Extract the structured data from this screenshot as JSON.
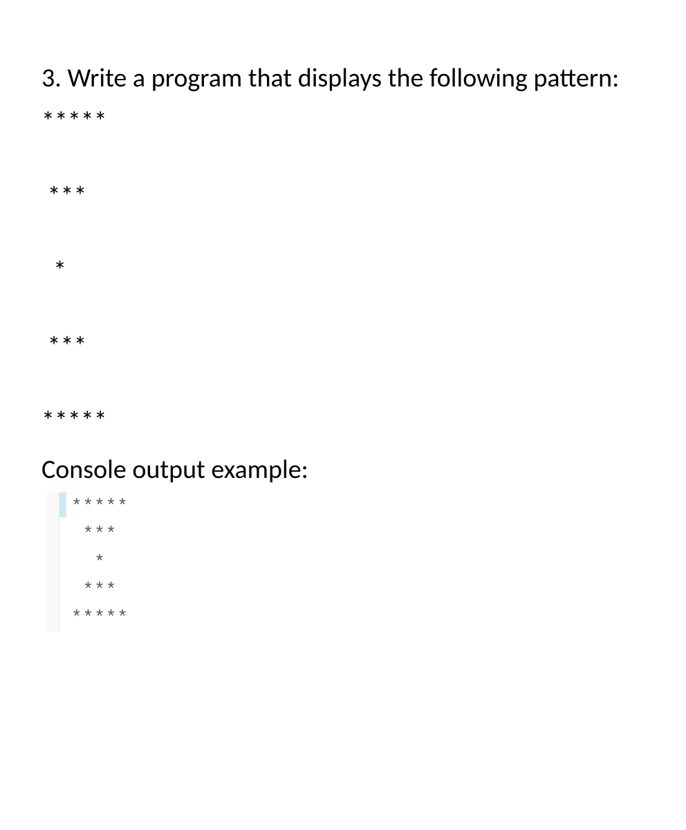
{
  "question": {
    "prompt": "3. Write a program that displays the following pattern:"
  },
  "pattern": {
    "line1": "*****",
    "line2": " ***",
    "line3": "  *",
    "line4": " ***",
    "line5": "*****"
  },
  "console": {
    "label": "Console output example:",
    "output": {
      "line1": "*****",
      "line2": " ***",
      "line3": "  *",
      "line4": " ***",
      "line5": "*****"
    }
  }
}
